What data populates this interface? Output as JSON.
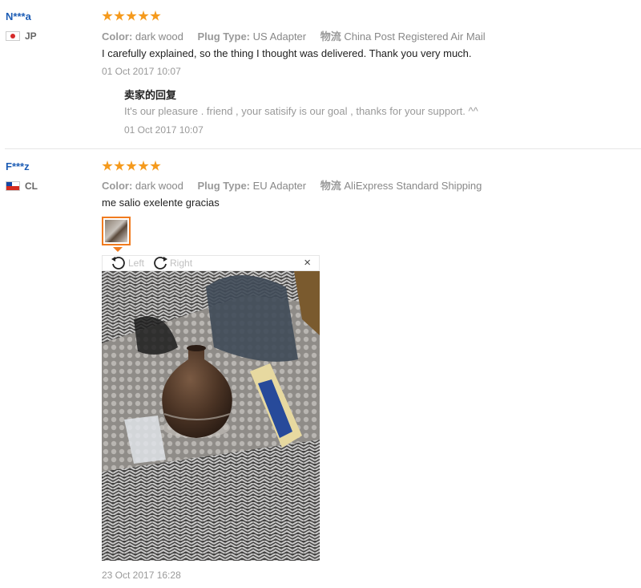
{
  "reviews": [
    {
      "user": "N***a",
      "country": "JP",
      "rating": 5,
      "attributes": [
        {
          "key": "Color:",
          "value": "dark wood"
        },
        {
          "key": "Plug Type:",
          "value": "US Adapter"
        },
        {
          "key": "物流",
          "value": "China Post Registered Air Mail"
        }
      ],
      "comment": "I carefully explained, so the thing I thought was delivered. Thank you very much.",
      "date": "01 Oct 2017 10:07",
      "reply": {
        "title": "卖家的回复",
        "text": "It's our pleasure . friend , your satisify is our goal , thanks for your support. ^^",
        "date": "01 Oct 2017 10:07"
      }
    },
    {
      "user": "F***z",
      "country": "CL",
      "rating": 5,
      "attributes": [
        {
          "key": "Color:",
          "value": "dark wood"
        },
        {
          "key": "Plug Type:",
          "value": "EU Adapter"
        },
        {
          "key": "物流",
          "value": "AliExpress Standard Shipping"
        }
      ],
      "comment": "me salio exelente gracias",
      "date": "23 Oct 2017 16:28",
      "viewer": {
        "rotate_left": "Left",
        "rotate_right": "Right",
        "close": "×"
      }
    }
  ],
  "colors": {
    "username": "#1d5db5",
    "star": "#f59a1c",
    "thumb_border": "#f07b1f"
  }
}
